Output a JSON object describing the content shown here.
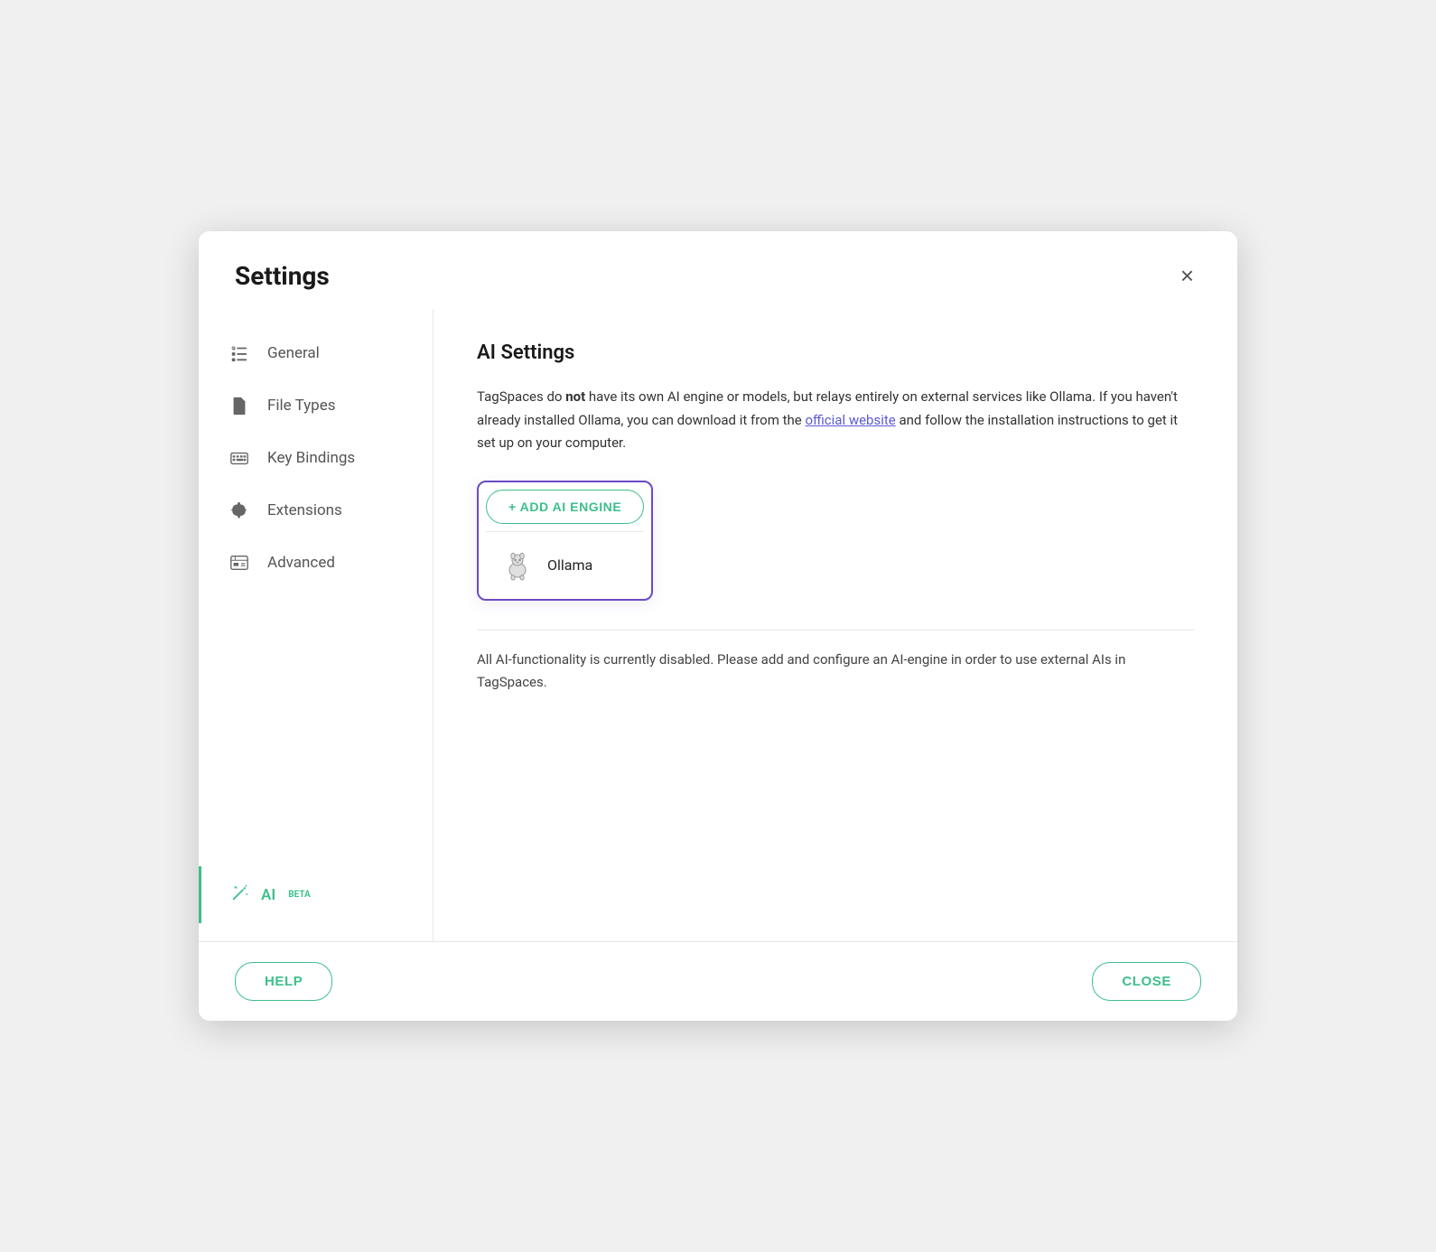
{
  "dialog": {
    "title": "Settings",
    "close_label": "×"
  },
  "sidebar": {
    "items": [
      {
        "id": "general",
        "label": "General",
        "icon": "checklist"
      },
      {
        "id": "file-types",
        "label": "File Types",
        "icon": "file"
      },
      {
        "id": "key-bindings",
        "label": "Key Bindings",
        "icon": "keyboard"
      },
      {
        "id": "extensions",
        "label": "Extensions",
        "icon": "puzzle"
      },
      {
        "id": "advanced",
        "label": "Advanced",
        "icon": "advanced"
      }
    ],
    "ai_item": {
      "label": "AI",
      "badge": "BETA"
    }
  },
  "main": {
    "section_title": "AI Settings",
    "description_part1": "TagSpaces do ",
    "description_bold": "not",
    "description_part2": " have its own AI engine or models, but relays entirely on external services like Ollama. If you haven't already installed Ollama, you can download it from the ",
    "description_link": "official website",
    "description_part3": " and follow the installation instructions to get it set up on your computer.",
    "add_engine_btn": "+ ADD AI ENGINE",
    "dropdown_item_label": "Ollama",
    "disabled_text": "All AI-functionality is currently disabled. Please add and configure an AI-engine in order to use external AIs in TagSpaces."
  },
  "footer": {
    "help_label": "HELP",
    "close_label": "CLOSE"
  }
}
